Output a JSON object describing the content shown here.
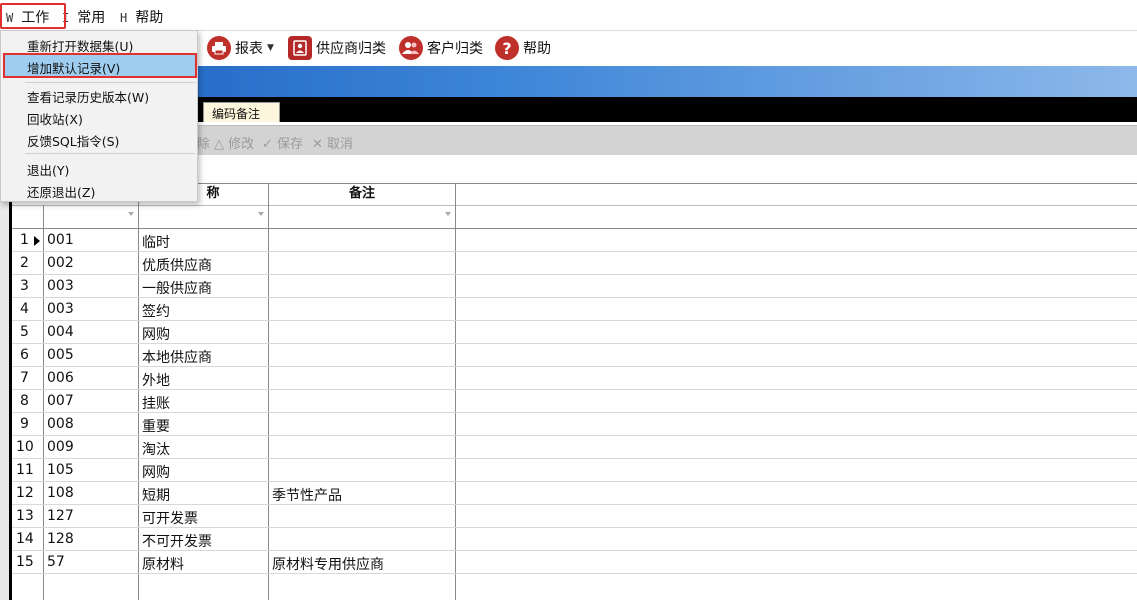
{
  "menubar": {
    "items": [
      {
        "key": "W",
        "label": "工作"
      },
      {
        "key": "I",
        "label": "常用"
      },
      {
        "key": "H",
        "label": "帮助"
      }
    ]
  },
  "toolbar": {
    "report": "报表",
    "supplier_category": "供应商归类",
    "customer_category": "客户归类",
    "help": "帮助",
    "partial_char": "ʳ"
  },
  "tabs": {
    "remark_tab": "编码备注"
  },
  "actions": {
    "delete_partial": "除",
    "edit": "修改",
    "save": "保存",
    "cancel": "取消"
  },
  "grid": {
    "headers": {
      "name_partial": "称",
      "remark": "备注"
    },
    "rows": [
      {
        "n": "1",
        "code": "001",
        "name": "临时",
        "remark": ""
      },
      {
        "n": "2",
        "code": "002",
        "name": "优质供应商",
        "remark": ""
      },
      {
        "n": "3",
        "code": "003",
        "name": "一般供应商",
        "remark": ""
      },
      {
        "n": "4",
        "code": "003",
        "name": "签约",
        "remark": ""
      },
      {
        "n": "5",
        "code": "004",
        "name": "网购",
        "remark": ""
      },
      {
        "n": "6",
        "code": "005",
        "name": "本地供应商",
        "remark": ""
      },
      {
        "n": "7",
        "code": "006",
        "name": "外地",
        "remark": ""
      },
      {
        "n": "8",
        "code": "007",
        "name": "挂账",
        "remark": ""
      },
      {
        "n": "9",
        "code": "008",
        "name": "重要",
        "remark": ""
      },
      {
        "n": "10",
        "code": "009",
        "name": "淘汰",
        "remark": ""
      },
      {
        "n": "11",
        "code": "105",
        "name": "网购",
        "remark": ""
      },
      {
        "n": "12",
        "code": "108",
        "name": "短期",
        "remark": "季节性产品"
      },
      {
        "n": "13",
        "code": "127",
        "name": "可开发票",
        "remark": ""
      },
      {
        "n": "14",
        "code": "128",
        "name": "不可开发票",
        "remark": ""
      },
      {
        "n": "15",
        "code": "57",
        "name": "原材料",
        "remark": "原材料专用供应商"
      }
    ]
  },
  "dropdown": {
    "items": [
      "重新打开数据集(U)",
      "增加默认记录(V)",
      "查看记录历史版本(W)",
      "回收站(X)",
      "反馈SQL指令(S)",
      "退出(Y)",
      "还原退出(Z)"
    ]
  },
  "colors": {
    "highlight_border": "#e03030",
    "selected_item": "#9fcdf0",
    "banner": "#1a5fc0"
  }
}
